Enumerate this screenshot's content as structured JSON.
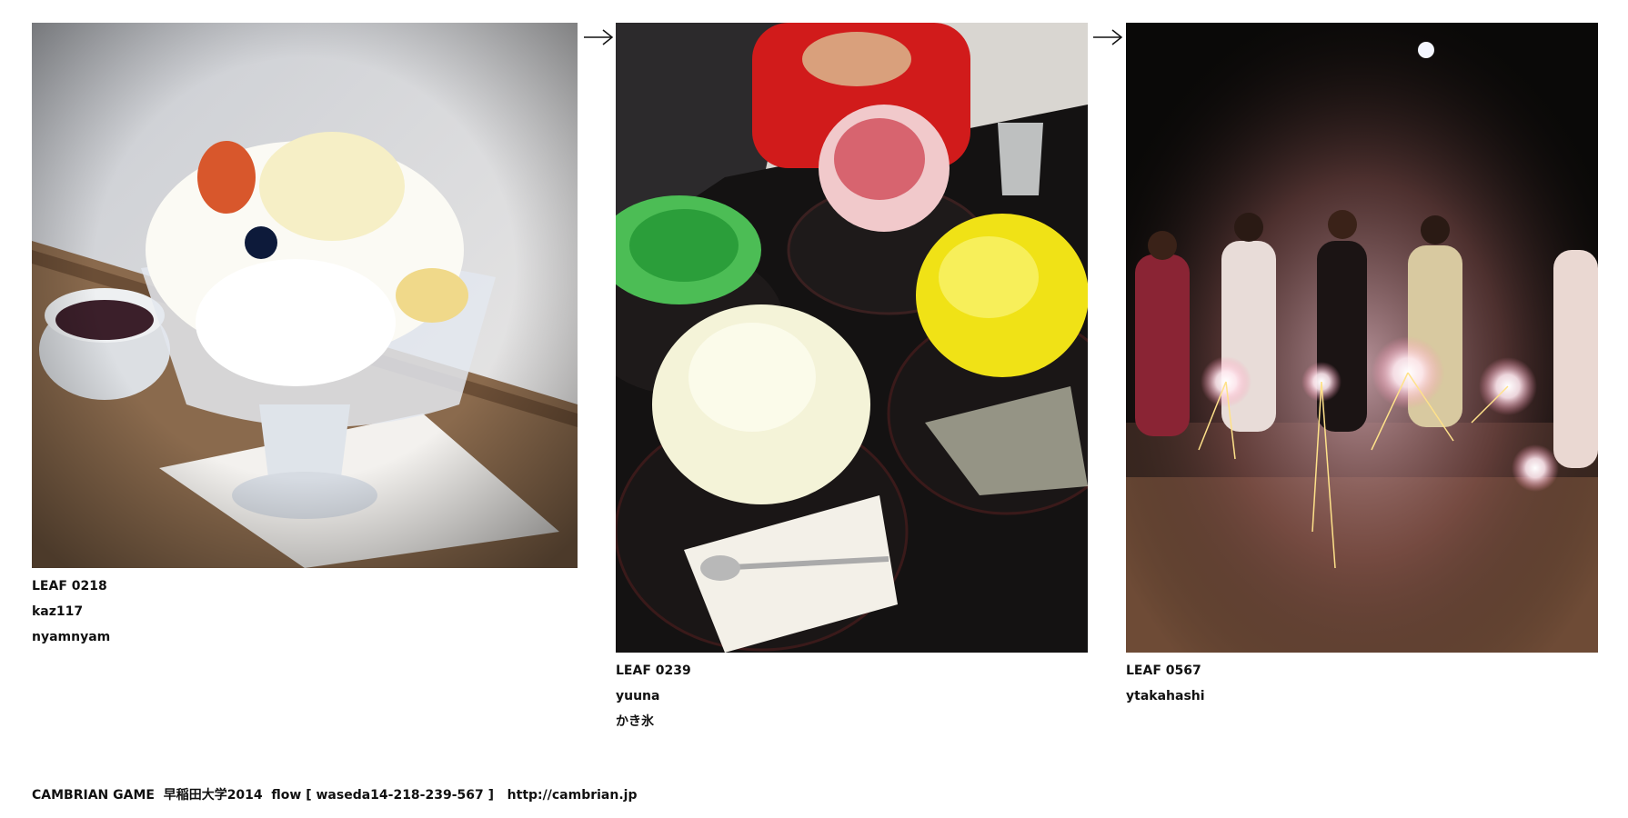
{
  "leaves": [
    {
      "id": "LEAF 0218",
      "user": "kaz117",
      "comment": "nyamnyam"
    },
    {
      "id": "LEAF 0239",
      "user": "yuuna",
      "comment": "かき氷"
    },
    {
      "id": "LEAF 0567",
      "user": "ytakahashi",
      "comment": ""
    }
  ],
  "footer": {
    "credit": "CAMBRIAN GAME  早稲田大学2014  flow [ waseda14-218-239-567 ]",
    "link": "http://cambrian.jp"
  },
  "icons": {
    "arrow": "right-arrow-icon"
  }
}
